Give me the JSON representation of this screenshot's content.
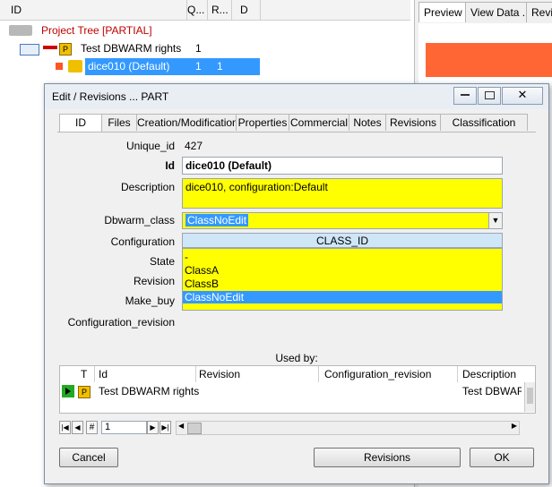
{
  "tree": {
    "columns": [
      "ID",
      "Q...",
      "R...",
      "D"
    ],
    "rows": [
      {
        "label": "Project Tree [PARTIAL]",
        "q": "",
        "r": ""
      },
      {
        "label": "Test DBWARM rights",
        "q": "1",
        "r": ""
      },
      {
        "label": "dice010 (Default)",
        "q": "1",
        "r": "1"
      }
    ]
  },
  "right_panel": {
    "tabs": [
      "Preview",
      "View Data ...",
      "Revi"
    ]
  },
  "dialog": {
    "title": "Edit / Revisions ... PART",
    "tabs": [
      "ID",
      "Files",
      "Creation/Modification",
      "Properties",
      "Commercial",
      "Notes",
      "Revisions",
      "Classification"
    ],
    "fields": {
      "unique_id_label": "Unique_id",
      "unique_id_value": "427",
      "id_label": "Id",
      "id_value": "dice010 (Default)",
      "description_label": "Description",
      "description_value": "dice010, configuration:Default",
      "dbwarm_class_label": "Dbwarm_class",
      "dbwarm_class_value": "ClassNoEdit",
      "configuration_label": "Configuration",
      "configuration_value": "CLASS_ID",
      "state_label": "State",
      "revision_label": "Revision",
      "make_buy_label": "Make_buy",
      "configuration_revision_label": "Configuration_revision"
    },
    "dropdown_options": [
      "-",
      "ClassA",
      "ClassB",
      "ClassNoEdit"
    ],
    "used_by": {
      "title": "Used by:",
      "columns": [
        "T",
        "Id",
        "Revision",
        "Configuration_revision",
        "Description"
      ],
      "rows": [
        {
          "id": "Test DBWARM rights",
          "revision": "",
          "configuration_revision": "",
          "description": "Test DBWARI"
        }
      ]
    },
    "pager": {
      "hash": "#",
      "page": "1"
    },
    "buttons": {
      "cancel": "Cancel",
      "revisions": "Revisions",
      "ok": "OK"
    }
  }
}
